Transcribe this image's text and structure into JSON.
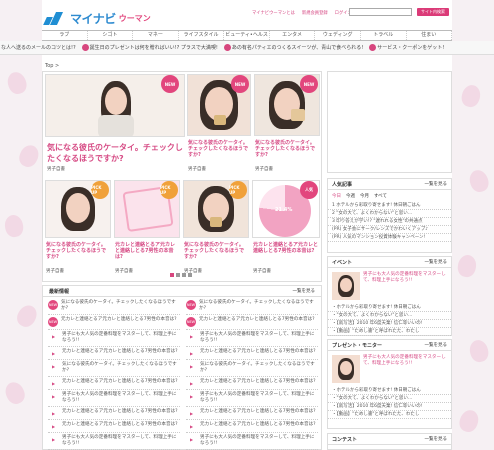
{
  "header": {
    "logo_main": "マイナビ",
    "logo_sub": "ウーマン",
    "links": [
      "マイナビウーマンとは",
      "新規会員登録",
      "ログイン"
    ],
    "search_button": "サイト内検索"
  },
  "nav": [
    "ラブ",
    "シゴト",
    "マネー",
    "ライフスタイル",
    "ビューティ•ヘルス",
    "エンタメ",
    "ウェディング",
    "トラベル",
    "住まい"
  ],
  "ticker": [
    "な人へ送るのメールのコツとは!?",
    "誕生日のプレゼントは何を贈ればいい!? プラスで大満喫!",
    "あの有名パティエのつくるスイーツが、青山で食べられる!",
    "サービス・クーポンをゲット!"
  ],
  "breadcrumb": "Top >",
  "feature": {
    "main": {
      "caption": "気になる彼氏のケータイ。チェックしたくなるほうですか?",
      "author": "男子自書",
      "badge": "NEW"
    },
    "sub": [
      {
        "caption": "気になる彼氏のケータイ。チェックしたくなるほうですか?",
        "author": "男子自書",
        "badge": "NEW"
      },
      {
        "caption": "気になる彼氏のケータイ。チェックしたくなるほうですか?",
        "author": "男子自書",
        "badge": "NEW"
      }
    ],
    "row": [
      {
        "caption": "気になる彼氏のケータイ。チェックしたくなるほうですか?",
        "author": "男子自書",
        "badge": "PICK UP"
      },
      {
        "caption": "元カレと連絡とるア元カレと連絡しとる7男性の本音は?",
        "author": "男子自書",
        "badge": "PICK UP"
      },
      {
        "caption": "気になる彼氏のケータイ。チェックしたくなるほうですか?",
        "author": "男子自書",
        "badge": "PICK UP"
      },
      {
        "caption": "元カレと連絡とるア元カレと連絡しとる7男性の本音は?",
        "author": "男子自書",
        "badge": "人気"
      }
    ],
    "pie_percent": "21.4%"
  },
  "news": {
    "title": "最新情報",
    "more": "一覧を見る",
    "left": [
      {
        "badge": "NEW",
        "text": "気になる彼氏のケータイ。チェックしたくなるほうですか?"
      },
      {
        "badge": "NEW",
        "text": "元カレと連絡とるア元カレと連絡しとる7男性の本音は?"
      },
      {
        "badge": "",
        "text": "男子にも大人気の定番料理をマスターして、料理上手になろう!!"
      },
      {
        "badge": "",
        "text": "元カレと連絡とるア元カレと連絡しとる7男性の本音は?"
      },
      {
        "badge": "",
        "text": "気になる彼氏のケータイ。チェックしたくなるほうですか?"
      },
      {
        "badge": "",
        "text": "元カレと連絡とるア元カレと連絡しとる7男性の本音は?"
      },
      {
        "badge": "",
        "text": "男子にも大人気の定番料理をマスターして、料理上手になろう!!"
      },
      {
        "badge": "",
        "text": "元カレと連絡とるア元カレと連絡しとる7男性の本音は?"
      },
      {
        "badge": "",
        "text": "元カレと連絡とるア元カレと連絡しとる7男性の本音は?"
      },
      {
        "badge": "",
        "text": "男子にも大人気の定番料理をマスターして、料理上手になろう!!"
      },
      {
        "badge": "",
        "text": "(PR) 女子会にサーク/レンズでかわいくアップ♪"
      }
    ],
    "right": [
      {
        "badge": "NEW",
        "text": "気になる彼氏のケータイ。チェックしたくなるほうですか?"
      },
      {
        "badge": "NEW",
        "text": "元カレと連絡とるア元カレと連絡しとる7男性の本音は?"
      },
      {
        "badge": "",
        "text": "男子にも大人気の定番料理をマスターして、料理上手になろう!!"
      },
      {
        "badge": "",
        "text": "元カレと連絡とるア元カレと連絡しとる7男性の本音は?"
      },
      {
        "badge": "",
        "text": "気になる彼氏のケータイ。チェックしたくなるほうですか?"
      },
      {
        "badge": "",
        "text": "元カレと連絡とるア元カレと連絡しとる7男性の本音は?"
      },
      {
        "badge": "",
        "text": "男子にも大人気の定番料理をマスターして、料理上手になろう!!"
      },
      {
        "badge": "",
        "text": "元カレと連絡とるア元カレと連絡しとる7男性の本音は?"
      },
      {
        "badge": "",
        "text": "元カレと連絡とるア元カレと連絡しとる7男性の本音は?"
      },
      {
        "badge": "",
        "text": "男子にも大人気の定番料理をマスターして、料理上手になろう!!"
      },
      {
        "badge": "",
        "text": "(PR) 女子会にサーク/レンズでかわいくアップ♪"
      }
    ]
  },
  "popular": {
    "title": "人気記事",
    "more": "一覧を見る",
    "tabs": [
      "今日",
      "今週",
      "今月",
      "すべて"
    ],
    "items": [
      "1 ホテルから彩取り寄せます! 休日朝ごはん",
      "2 \"女の大て、よくわからない\"と思い…",
      "3 印り答えが学い!? \"遅れれる女性\"の共通点",
      "(PR) 女子会にサーク/レンズでかわいくアップ♪",
      "(PR) 人気のマンション投資体験キャンペーン!"
    ]
  },
  "event": {
    "title": "イベント",
    "more": "一覧を見る",
    "feature": "男子にも大人気の定番料理をマスターして、料理上手になろう!!",
    "items": [
      "・ホテルから彩取り寄せます! 休日朝ごはん",
      "・\"女の大て、よくわからない\"と思い…",
      "・【就写活】2010 年6度天業! 信仁等いいの!",
      "・【動画】\"ためし書\"と呼ばれたた、わたし"
    ]
  },
  "present": {
    "title": "プレゼント・モニター",
    "more": "一覧を見る",
    "feature": "男子にも大人気の定番料理をマスターして、料理上手になろう!!",
    "items": [
      "・ホテルから彩取り寄せます! 休日朝ごはん",
      "・\"女の大て、よくわからない\"と思い…",
      "・【就写活】2010 年6度天業! 信仁等いいの!",
      "・【動画】\"ためし書\"と呼ばれたた、わたし"
    ]
  },
  "contest": {
    "title": "コンテスト",
    "more": "一覧を見る"
  }
}
